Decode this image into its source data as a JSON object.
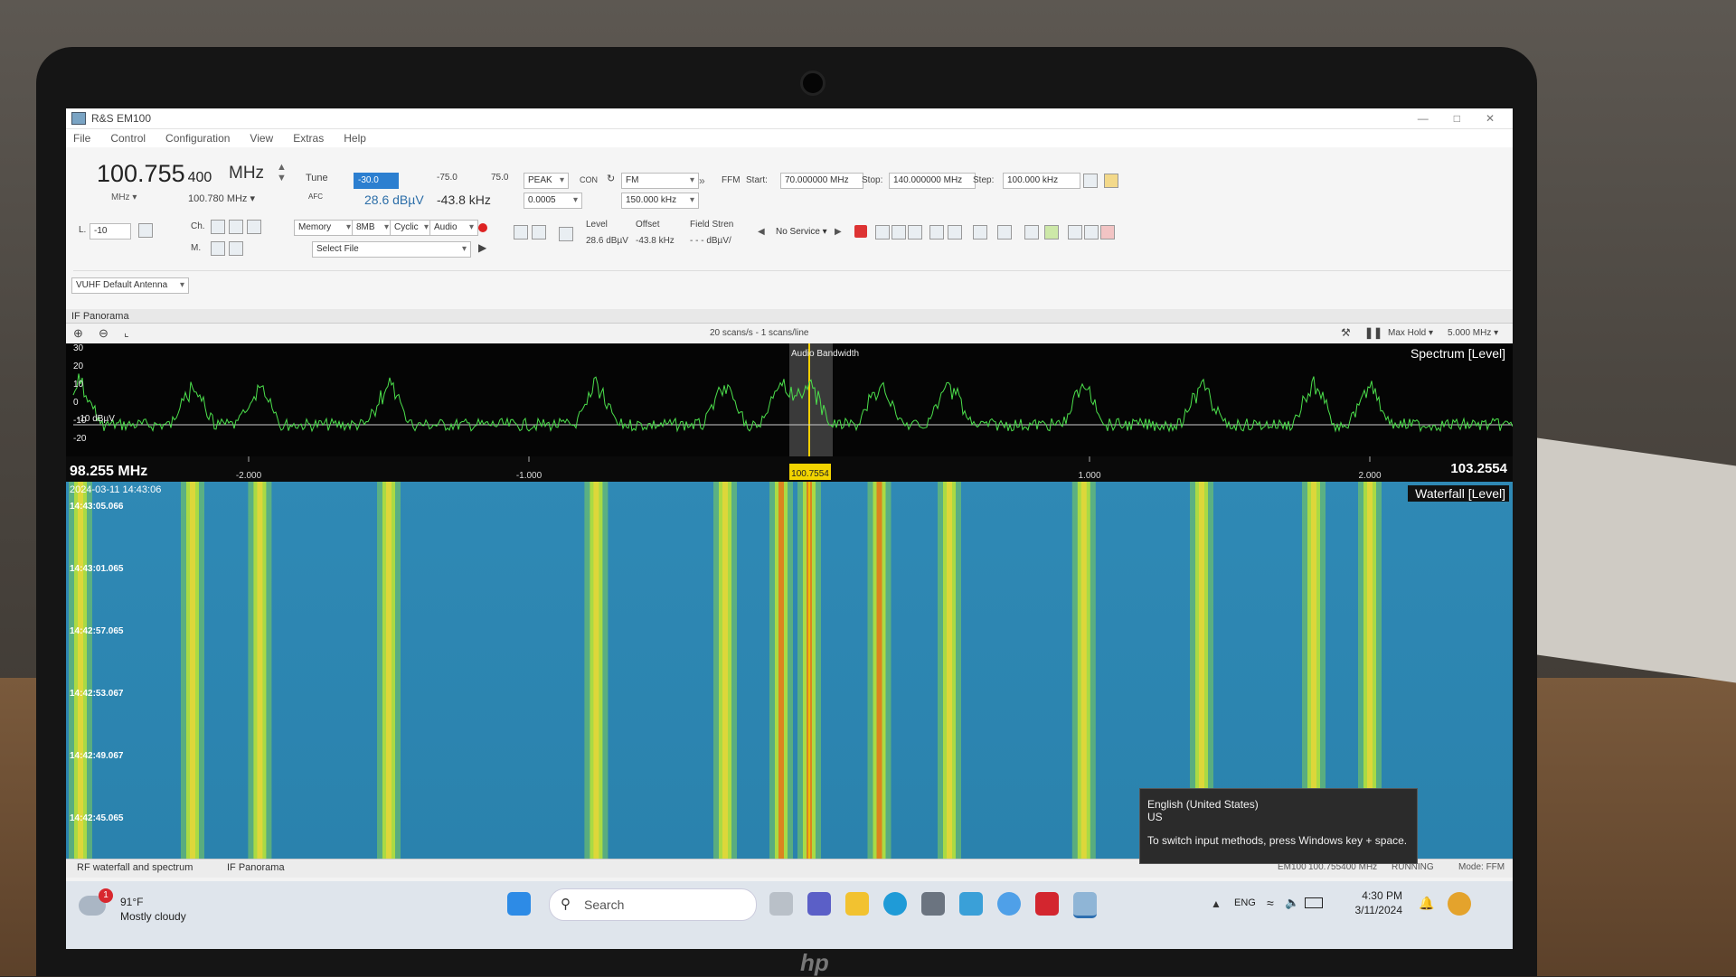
{
  "window": {
    "title": "R&S EM100",
    "menu": [
      "File",
      "Control",
      "Configuration",
      "View",
      "Extras",
      "Help"
    ]
  },
  "receiver": {
    "frequency_main": "100.755",
    "frequency_fine": "400",
    "frequency_unit": "MHz",
    "sub_unit": "MHz",
    "sub_frequency": "100.780",
    "sub_frequency_unit": "MHz",
    "tune_label": "Tune",
    "afc_label": "AFC",
    "level_setting": "-30.0",
    "level_value": "28.6 dBµV",
    "offset_low": "-75.0",
    "offset_high": "75.0",
    "offset_value": "-43.8 kHz",
    "detector": "PEAK",
    "detector_value": "0.0005",
    "con_label": "CON",
    "demod": "FM",
    "bandwidth": "150.000 kHz",
    "level_label": "Level",
    "offset_label": "Offset",
    "field_strength_label": "Field Stren",
    "level_reading": "28.6 dBµV",
    "offset_reading": "-43.8 kHz",
    "field_strength_reading": "- - - dBµV/",
    "attenuation": "-10",
    "ch_label": "Ch.",
    "mem_label": "M.",
    "memory_select": "Memory",
    "buffer_select": "8MB",
    "cyclic_select": "Cyclic",
    "audio_select": "Audio",
    "file_select": "Select File",
    "service_select": "No Service",
    "antenna": "VUHF Default Antenna"
  },
  "scan": {
    "mode": "FFM",
    "start_label": "Start:",
    "start_value": "70.000000 MHz",
    "stop_label": "Stop:",
    "stop_value": "140.000000 MHz",
    "step_label": "Step:",
    "step_value": "100.000 kHz"
  },
  "panorama": {
    "panel_title": "IF Panorama",
    "scan_rate": "20 scans/s - 1 scans/line",
    "hold_mode": "Max Hold",
    "span": "5.000 MHz",
    "spectrum_label": "Spectrum [Level]",
    "waterfall_label": "Waterfall [Level]",
    "audio_bw_label": "Audio Bandwidth",
    "y_ticks": [
      "30",
      "20",
      "10",
      "0",
      "-10",
      "-20"
    ],
    "threshold_label": "-10 dBµV",
    "freq_left": "98.255 MHz",
    "freq_right": "103.2554",
    "freq_center": "100.7554",
    "offset_ticks": [
      "-2.000",
      "-1.000",
      "1.000",
      "2.000"
    ],
    "date_label": "2024-03-11 14:43:06",
    "time_labels": [
      "14:43:05.066",
      "14:43:01.065",
      "14:42:57.065",
      "14:42:53.067",
      "14:42:49.067",
      "14:42:45.065"
    ]
  },
  "bottom_tabs": [
    "RF waterfall and spectrum",
    "IF Panorama"
  ],
  "statusbar": {
    "device": "EM100",
    "frequency": "100.755400 MHz",
    "state": "RUNNING",
    "mode": "Mode: FFM"
  },
  "tooltip": {
    "language": "English (United States)",
    "layout": "US",
    "hint": "To switch input methods, press Windows key + space."
  },
  "taskbar": {
    "weather_temp": "91°F",
    "weather_desc": "Mostly cloudy",
    "weather_badge": "1",
    "search_placeholder": "Search",
    "language": "ENG",
    "time": "4:30 PM",
    "date": "3/11/2024"
  },
  "signal_peaks_offset_mhz": [
    -2.6,
    -2.2,
    -1.96,
    -1.5,
    -0.76,
    -0.3,
    -0.1,
    0.0,
    0.25,
    0.5,
    0.98,
    1.4,
    1.8,
    2.0
  ]
}
